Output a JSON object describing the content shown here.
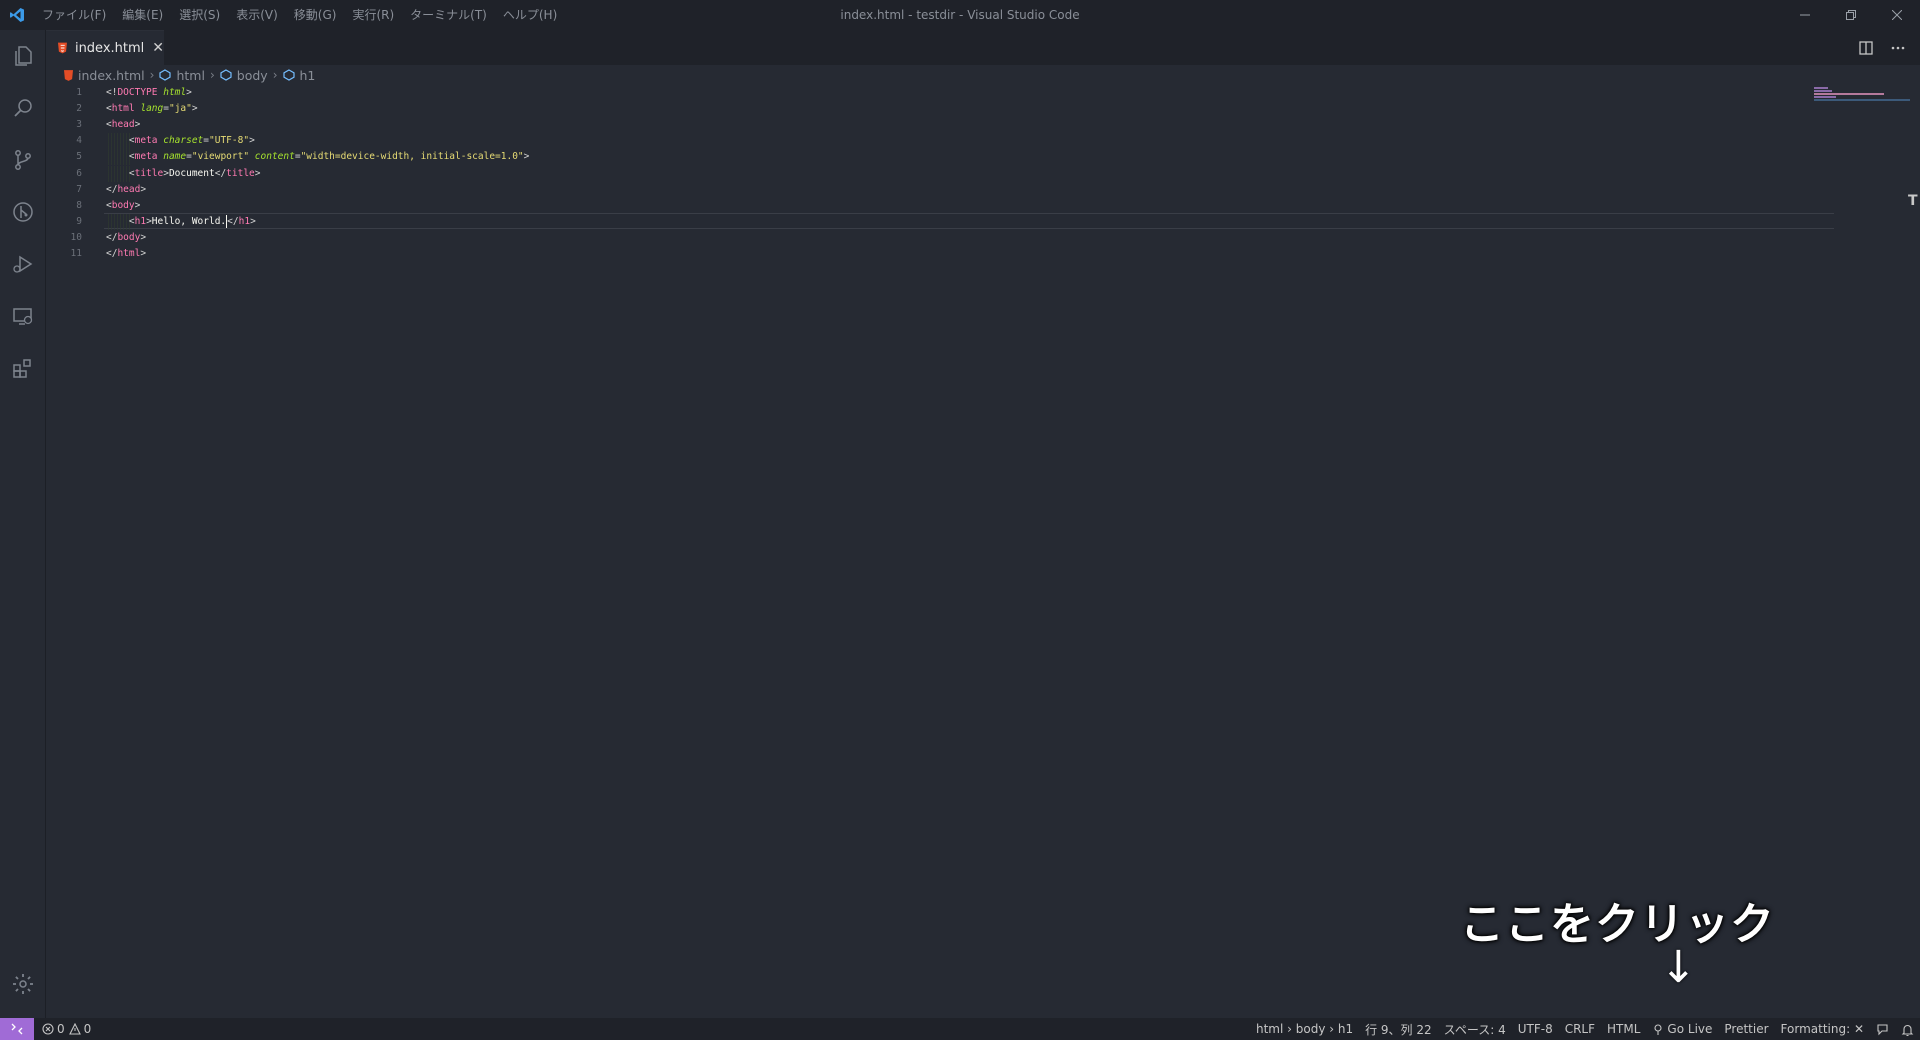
{
  "window": {
    "title": "index.html - testdir - Visual Studio Code"
  },
  "menu": [
    "ファイル(F)",
    "編集(E)",
    "選択(S)",
    "表示(V)",
    "移動(G)",
    "実行(R)",
    "ターミナル(T)",
    "ヘルプ(H)"
  ],
  "tab": {
    "label": "index.html",
    "close": "✕"
  },
  "breadcrumb": [
    "index.html",
    "html",
    "body",
    "h1"
  ],
  "editor": {
    "line_numbers": [
      "1",
      "2",
      "3",
      "4",
      "5",
      "6",
      "7",
      "8",
      "9",
      "10",
      "11"
    ],
    "lines": [
      [
        {
          "t": "<!",
          "c": "t-punc"
        },
        {
          "t": "DOCTYPE",
          "c": "t-kw"
        },
        {
          "t": " ",
          "c": "t-punc"
        },
        {
          "t": "html",
          "c": "t-attr"
        },
        {
          "t": ">",
          "c": "t-punc"
        }
      ],
      [
        {
          "t": "<",
          "c": "t-punc"
        },
        {
          "t": "html",
          "c": "t-tag"
        },
        {
          "t": " ",
          "c": "t-punc"
        },
        {
          "t": "lang",
          "c": "t-attr"
        },
        {
          "t": "=",
          "c": "t-punc"
        },
        {
          "t": "\"ja\"",
          "c": "t-str"
        },
        {
          "t": ">",
          "c": "t-punc"
        }
      ],
      [
        {
          "t": "<",
          "c": "t-punc"
        },
        {
          "t": "head",
          "c": "t-tag"
        },
        {
          "t": ">",
          "c": "t-punc"
        }
      ],
      [
        {
          "t": "    <",
          "c": "t-punc"
        },
        {
          "t": "meta",
          "c": "t-tag"
        },
        {
          "t": " ",
          "c": "t-punc"
        },
        {
          "t": "charset",
          "c": "t-attr"
        },
        {
          "t": "=",
          "c": "t-punc"
        },
        {
          "t": "\"UTF-8\"",
          "c": "t-str"
        },
        {
          "t": ">",
          "c": "t-punc"
        }
      ],
      [
        {
          "t": "    <",
          "c": "t-punc"
        },
        {
          "t": "meta",
          "c": "t-tag"
        },
        {
          "t": " ",
          "c": "t-punc"
        },
        {
          "t": "name",
          "c": "t-attr"
        },
        {
          "t": "=",
          "c": "t-punc"
        },
        {
          "t": "\"viewport\"",
          "c": "t-str"
        },
        {
          "t": " ",
          "c": "t-punc"
        },
        {
          "t": "content",
          "c": "t-attr"
        },
        {
          "t": "=",
          "c": "t-punc"
        },
        {
          "t": "\"width=device-width, initial-scale=1.0\"",
          "c": "t-str"
        },
        {
          "t": ">",
          "c": "t-punc"
        }
      ],
      [
        {
          "t": "    <",
          "c": "t-punc"
        },
        {
          "t": "title",
          "c": "t-tag"
        },
        {
          "t": ">",
          "c": "t-punc"
        },
        {
          "t": "Document",
          "c": "t-text"
        },
        {
          "t": "</",
          "c": "t-punc"
        },
        {
          "t": "title",
          "c": "t-tag"
        },
        {
          "t": ">",
          "c": "t-punc"
        }
      ],
      [
        {
          "t": "</",
          "c": "t-punc"
        },
        {
          "t": "head",
          "c": "t-tag"
        },
        {
          "t": ">",
          "c": "t-punc"
        }
      ],
      [
        {
          "t": "<",
          "c": "t-punc"
        },
        {
          "t": "body",
          "c": "t-tag"
        },
        {
          "t": ">",
          "c": "t-punc"
        }
      ],
      [
        {
          "t": "    <",
          "c": "t-punc"
        },
        {
          "t": "h1",
          "c": "t-tag"
        },
        {
          "t": ">",
          "c": "t-punc"
        },
        {
          "t": "Hello, World.",
          "c": "t-text"
        },
        {
          "t": "|CARET|",
          "c": "caret"
        },
        {
          "t": "</",
          "c": "t-punc"
        },
        {
          "t": "h1",
          "c": "t-tag"
        },
        {
          "t": ">",
          "c": "t-punc"
        }
      ],
      [
        {
          "t": "</",
          "c": "t-punc"
        },
        {
          "t": "body",
          "c": "t-tag"
        },
        {
          "t": ">",
          "c": "t-punc"
        }
      ],
      [
        {
          "t": "</",
          "c": "t-punc"
        },
        {
          "t": "html",
          "c": "t-tag"
        },
        {
          "t": ">",
          "c": "t-punc"
        }
      ]
    ]
  },
  "annotation": {
    "text": "ここをクリック",
    "arrow": "↓"
  },
  "statusbar": {
    "errors": "0",
    "warnings": "0",
    "breadcrumb": "html › body › h1",
    "position": "行 9、列 22",
    "spaces": "スペース: 4",
    "encoding": "UTF-8",
    "eol": "CRLF",
    "language": "HTML",
    "go_live": "Go Live",
    "prettier": "Prettier",
    "formatting": "Formatting: ✕"
  },
  "colors": {
    "remote_accent": "#a06bd6",
    "editor_bg": "#262a33",
    "chrome_bg": "#1f2229"
  }
}
